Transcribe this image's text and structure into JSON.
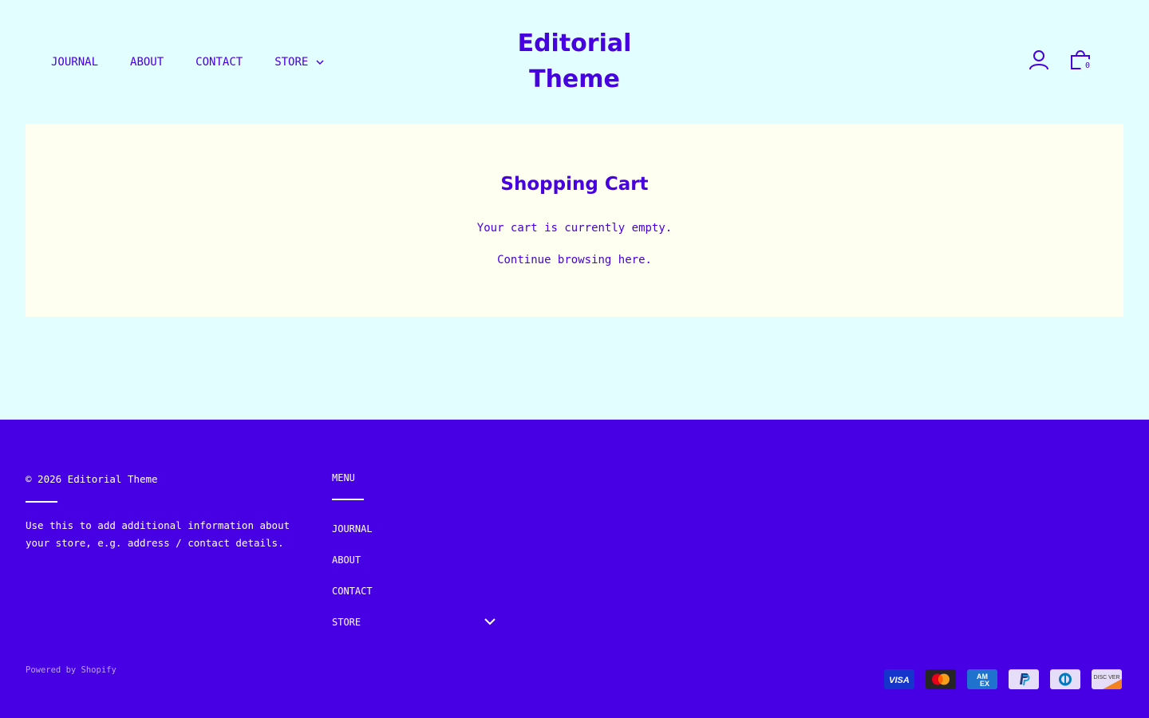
{
  "header": {
    "nav": [
      {
        "label": "JOURNAL"
      },
      {
        "label": "ABOUT"
      },
      {
        "label": "CONTACT"
      },
      {
        "label": "STORE"
      }
    ],
    "logo_line1": "Editorial",
    "logo_line2": "Theme",
    "cart_count": "0"
  },
  "cart": {
    "title": "Shopping Cart",
    "empty_message": "Your cart is currently empty.",
    "continue_prefix": "Continue browsing ",
    "continue_link": "here",
    "continue_suffix": "."
  },
  "footer": {
    "copyright": "© 2026 Editorial Theme",
    "about_text": "Use this to add additional information about your store, e.g. address / contact details.",
    "menu_heading": "MENU",
    "menu_items": [
      {
        "label": "JOURNAL"
      },
      {
        "label": "ABOUT"
      },
      {
        "label": "CONTACT"
      },
      {
        "label": "STORE"
      }
    ],
    "powered_by": "Powered by Shopify",
    "payment_icons": [
      "visa-icon",
      "mastercard-icon",
      "amex-icon",
      "paypal-icon",
      "diners-club-icon",
      "discover-icon"
    ]
  },
  "colors": {
    "background": "#e2fefe",
    "accent": "#4700e0",
    "panel": "#fefff0",
    "footer": "#4700e3"
  }
}
